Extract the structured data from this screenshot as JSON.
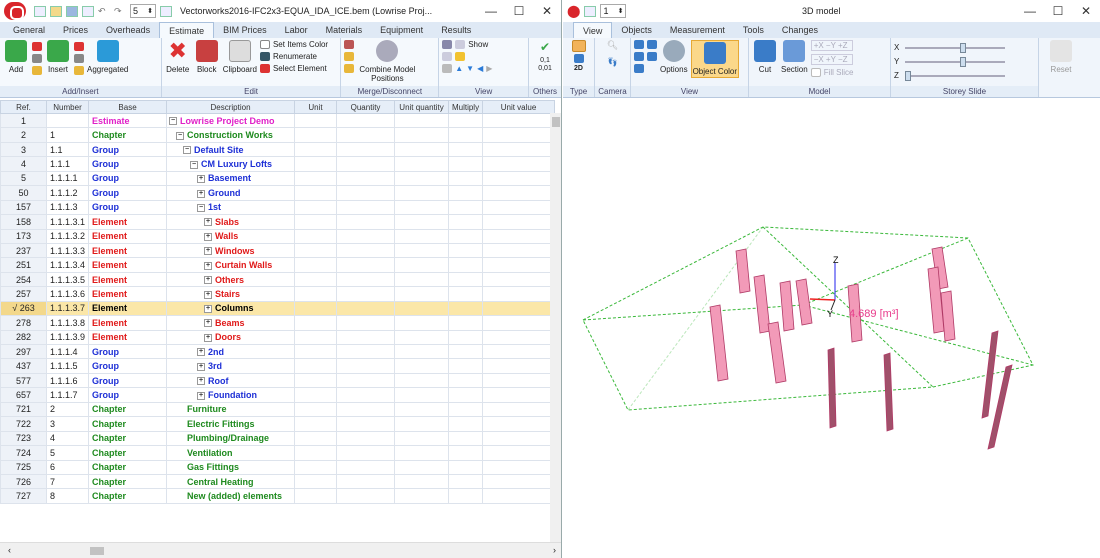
{
  "left": {
    "title": "Vectorworks2016-IFC2x3-EQUA_IDA_ICE.bem (Lowrise Proj...",
    "spin_value": "5",
    "tabs": [
      "General",
      "Prices",
      "Overheads",
      "Estimate",
      "BIM Prices",
      "Labor",
      "Materials",
      "Equipment",
      "Results"
    ],
    "ribbon": {
      "add": "Add",
      "insert": "Insert",
      "aggregated": "Aggregated",
      "delete": "Delete",
      "block": "Block",
      "clipboard": "Clipboard",
      "set_items_color": "Set Items Color",
      "renumerate": "Renumerate",
      "select_element": "Select Element",
      "combine_model_positions": "Combine Model Positions",
      "show": "Show",
      "group_add_insert": "Add/Insert",
      "group_edit": "Edit",
      "group_merge": "Merge/Disconnect",
      "group_view": "View",
      "group_others": "Others",
      "others_label": "0,1\n0,01"
    },
    "columns": [
      "Ref.",
      "Number",
      "Base",
      "Description",
      "Unit",
      "Quantity",
      "Unit quantity",
      "Multiply",
      "Unit value"
    ],
    "rows": [
      {
        "ref": "1",
        "number": "",
        "base": "Estimate",
        "desc": "Lowrise Project Demo",
        "level": 0,
        "tog": "−",
        "kind": "estimate"
      },
      {
        "ref": "2",
        "number": "1",
        "base": "Chapter",
        "desc": "Construction Works",
        "level": 1,
        "tog": "−",
        "kind": "chapter"
      },
      {
        "ref": "3",
        "number": "1.1",
        "base": "Group",
        "desc": "Default Site",
        "level": 2,
        "tog": "−",
        "kind": "group"
      },
      {
        "ref": "4",
        "number": "1.1.1",
        "base": "Group",
        "desc": "CM Luxury Lofts",
        "level": 3,
        "tog": "−",
        "kind": "group"
      },
      {
        "ref": "5",
        "number": "1.1.1.1",
        "base": "Group",
        "desc": "Basement",
        "level": 4,
        "tog": "+",
        "kind": "group"
      },
      {
        "ref": "50",
        "number": "1.1.1.2",
        "base": "Group",
        "desc": "Ground",
        "level": 4,
        "tog": "+",
        "kind": "group"
      },
      {
        "ref": "157",
        "number": "1.1.1.3",
        "base": "Group",
        "desc": "1st",
        "level": 4,
        "tog": "−",
        "kind": "group"
      },
      {
        "ref": "158",
        "number": "1.1.1.3.1",
        "base": "Element",
        "desc": "Slabs",
        "level": 5,
        "tog": "+",
        "kind": "element"
      },
      {
        "ref": "173",
        "number": "1.1.1.3.2",
        "base": "Element",
        "desc": "Walls",
        "level": 5,
        "tog": "+",
        "kind": "element"
      },
      {
        "ref": "237",
        "number": "1.1.1.3.3",
        "base": "Element",
        "desc": "Windows",
        "level": 5,
        "tog": "+",
        "kind": "element"
      },
      {
        "ref": "251",
        "number": "1.1.1.3.4",
        "base": "Element",
        "desc": "Curtain Walls",
        "level": 5,
        "tog": "+",
        "kind": "element"
      },
      {
        "ref": "254",
        "number": "1.1.1.3.5",
        "base": "Element",
        "desc": "Others",
        "level": 5,
        "tog": "+",
        "kind": "element"
      },
      {
        "ref": "257",
        "number": "1.1.1.3.6",
        "base": "Element",
        "desc": "Stairs",
        "level": 5,
        "tog": "+",
        "kind": "element"
      },
      {
        "ref": "√ 263",
        "number": "1.1.1.3.7",
        "base": "Element",
        "desc": "Columns",
        "level": 5,
        "tog": "+",
        "kind": "selected"
      },
      {
        "ref": "278",
        "number": "1.1.1.3.8",
        "base": "Element",
        "desc": "Beams",
        "level": 5,
        "tog": "+",
        "kind": "element"
      },
      {
        "ref": "282",
        "number": "1.1.1.3.9",
        "base": "Element",
        "desc": "Doors",
        "level": 5,
        "tog": "+",
        "kind": "element"
      },
      {
        "ref": "297",
        "number": "1.1.1.4",
        "base": "Group",
        "desc": "2nd",
        "level": 4,
        "tog": "+",
        "kind": "group"
      },
      {
        "ref": "437",
        "number": "1.1.1.5",
        "base": "Group",
        "desc": "3rd",
        "level": 4,
        "tog": "+",
        "kind": "group"
      },
      {
        "ref": "577",
        "number": "1.1.1.6",
        "base": "Group",
        "desc": "Roof",
        "level": 4,
        "tog": "+",
        "kind": "group"
      },
      {
        "ref": "657",
        "number": "1.1.1.7",
        "base": "Group",
        "desc": "Foundation",
        "level": 4,
        "tog": "+",
        "kind": "group"
      },
      {
        "ref": "721",
        "number": "2",
        "base": "Chapter",
        "desc": "Furniture",
        "level": 1,
        "tog": "",
        "kind": "chapter"
      },
      {
        "ref": "722",
        "number": "3",
        "base": "Chapter",
        "desc": "Electric Fittings",
        "level": 1,
        "tog": "",
        "kind": "chapter"
      },
      {
        "ref": "723",
        "number": "4",
        "base": "Chapter",
        "desc": "Plumbing/Drainage",
        "level": 1,
        "tog": "",
        "kind": "chapter"
      },
      {
        "ref": "724",
        "number": "5",
        "base": "Chapter",
        "desc": "Ventilation",
        "level": 1,
        "tog": "",
        "kind": "chapter"
      },
      {
        "ref": "725",
        "number": "6",
        "base": "Chapter",
        "desc": "Gas Fittings",
        "level": 1,
        "tog": "",
        "kind": "chapter"
      },
      {
        "ref": "726",
        "number": "7",
        "base": "Chapter",
        "desc": "Central Heating",
        "level": 1,
        "tog": "",
        "kind": "chapter"
      },
      {
        "ref": "727",
        "number": "8",
        "base": "Chapter",
        "desc": "New (added) elements",
        "level": 1,
        "tog": "",
        "kind": "chapter"
      }
    ]
  },
  "right": {
    "title": "3D model",
    "spin_value": "1",
    "tabs": [
      "View",
      "Objects",
      "Measurement",
      "Tools",
      "Changes"
    ],
    "ribbon": {
      "options": "Options",
      "object_color": "Object Color",
      "cut": "Cut",
      "section": "Section",
      "fill_slice": "Fill Slice",
      "reset": "Reset",
      "x": "X",
      "y": "Y",
      "z": "Z",
      "group_type": "Type",
      "group_camera": "Camera",
      "group_view": "View",
      "group_model": "Model",
      "group_storey": "Storey Slide",
      "label_2d": "2D"
    },
    "axis_z": "Z",
    "axis_y": "Y",
    "volume": "4.689 [m³]"
  },
  "colors": {
    "estimate": "#e020c8",
    "chapter": "#1e8a1e",
    "group": "#1d2fd6",
    "element": "#e01919",
    "selected_row": "#fbe7a8",
    "column_fill": "#f29ab8",
    "bbox": "#3ab83a"
  }
}
